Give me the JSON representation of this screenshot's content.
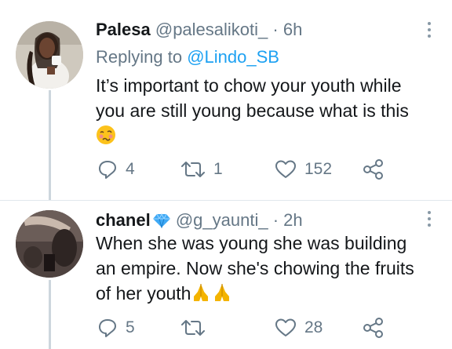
{
  "tweets": [
    {
      "name": "Palesa",
      "handle": "@palesalikoti_",
      "time": "· 6h",
      "reply_prefix": "Replying to ",
      "reply_mention": "@Lindo_SB",
      "line1": "It’s important to chow your youth while",
      "line2": "you are still young because what is this",
      "emoji": "woozy-face-emoji",
      "replies": "4",
      "retweets": "1",
      "likes": "152"
    },
    {
      "name": "chanel",
      "verified_emoji": "blue-diamond-emoji",
      "handle": "@g_yaunti_",
      "time": "· 2h",
      "line1": "When she was young she was building",
      "line2": "an empire. Now she's chowing the fruits",
      "line3": "of her youth",
      "emoji": "folded-hands-emoji",
      "replies": "5",
      "retweets": "",
      "likes": "28"
    }
  ],
  "colors": {
    "text": "#14171a",
    "secondary": "#657786",
    "link": "#1da1f2",
    "divider": "#e1e8ed"
  }
}
